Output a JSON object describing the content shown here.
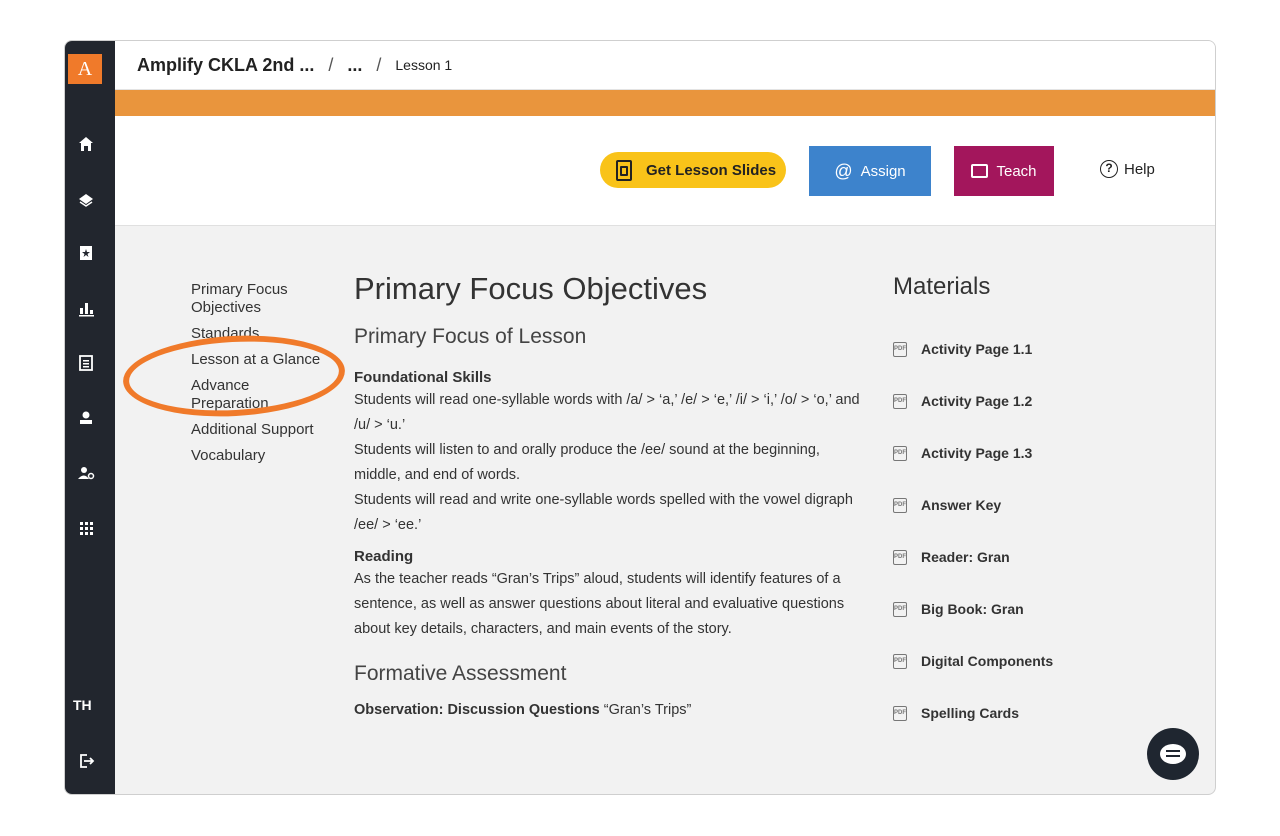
{
  "brand": {
    "logo_letter": "A",
    "accent_orange": "#e9953d",
    "rail_color": "#22262e"
  },
  "breadcrumb": {
    "app": "Amplify CKLA 2nd ...",
    "separator": "/",
    "ellipsis": "...",
    "lesson": "Lesson 1"
  },
  "rail": {
    "icons": [
      "home-icon",
      "layers-icon",
      "bookmark-star-icon",
      "bar-chart-icon",
      "document-list-icon",
      "teacher-icon",
      "user-settings-icon",
      "grid-icon",
      "logout-icon"
    ],
    "user_initials": "TH"
  },
  "toolbar": {
    "slides_label": "Get Lesson Slides",
    "assign_label": "Assign",
    "teach_label": "Teach",
    "help_label": "Help"
  },
  "toc": {
    "items": [
      "Primary Focus Objectives",
      "Standards",
      "Lesson at a Glance",
      "Advance Preparation",
      "Additional Support",
      "Vocabulary"
    ]
  },
  "main": {
    "title": "Primary Focus Objectives",
    "subtitle": "Primary Focus of Lesson",
    "foundational_heading": "Foundational Skills",
    "foundational_lines": [
      "Students will read one-syllable words with /a/ > ‘a,’ /e/ > ‘e,’ /i/ > ‘i,’ /o/ > ‘o,’ and /u/ > ‘u.’",
      "Students will listen to and orally produce the /ee/ sound at the beginning, middle, and end of words.",
      "Students will read and write one-syllable words spelled with the vowel digraph /ee/ > ‘ee.’"
    ],
    "reading_heading": "Reading",
    "reading_text": "As the teacher reads “Gran’s Trips” aloud, students will identify features of a sentence, as well as answer questions about literal and evaluative questions about key details, characters, and main events of the story.",
    "formative_heading": "Formative Assessment",
    "observation_bold": "Observation: Discussion Questions",
    "observation_rest": " “Gran’s Trips”"
  },
  "materials": {
    "title": "Materials",
    "items": [
      "Activity Page 1.1",
      "Activity Page 1.2",
      "Activity Page 1.3",
      "Answer Key",
      "Reader: Gran",
      "Big Book: Gran",
      "Digital Components",
      "Spelling Cards"
    ],
    "pdf_tag": "PDF"
  }
}
